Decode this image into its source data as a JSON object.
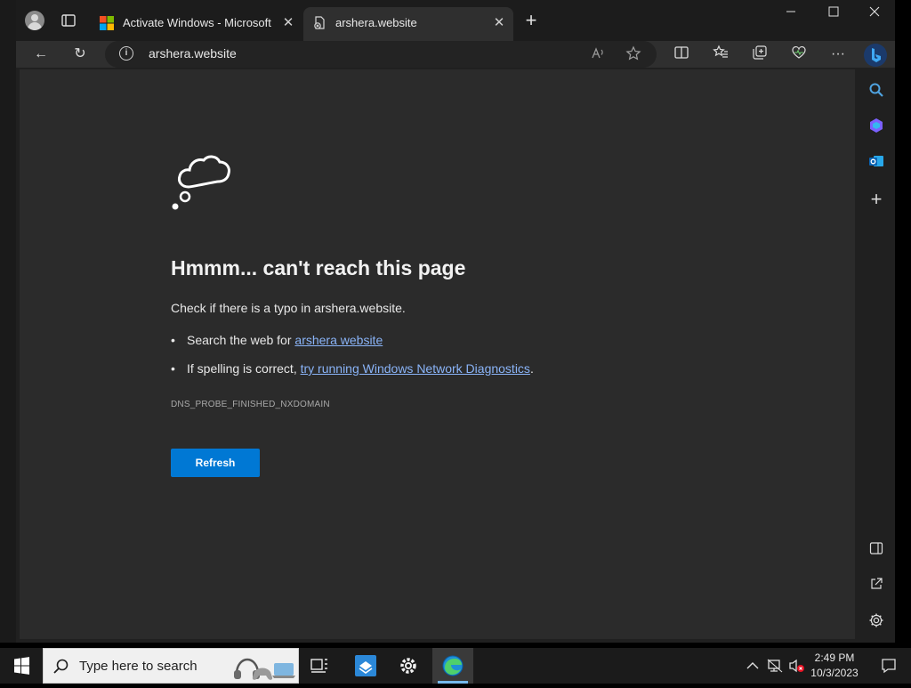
{
  "tabs": [
    {
      "title": "Activate Windows - Microsoft Su",
      "close": "✕",
      "active": false
    },
    {
      "title": "arshera.website",
      "close": "✕",
      "active": true
    }
  ],
  "new_tab": "+",
  "window_controls": {
    "minimize": "—",
    "maximize": "☐",
    "close": "✕"
  },
  "address": {
    "url": "arshera.website",
    "info": "i"
  },
  "toolbar": {
    "back": "←",
    "reload": "↻",
    "more": "···"
  },
  "page": {
    "headline": "Hmmm... can't reach this page",
    "subtext": "Check if there is a typo in arshera.website.",
    "bullets": [
      {
        "prefix": "Search the web for ",
        "link": "arshera website",
        "suffix": ""
      },
      {
        "prefix": "If spelling is correct, ",
        "link": "try running Windows Network Diagnostics",
        "suffix": "."
      }
    ],
    "error_code": "DNS_PROBE_FINISHED_NXDOMAIN",
    "refresh_label": "Refresh"
  },
  "sidebar": {
    "add": "+"
  },
  "taskbar": {
    "search_placeholder": "Type here to search",
    "time": "2:49 PM",
    "date": "10/3/2023"
  },
  "colors": {
    "accent": "#0078d4",
    "link": "#8ab4f8",
    "page_bg": "#2b2b2b"
  }
}
